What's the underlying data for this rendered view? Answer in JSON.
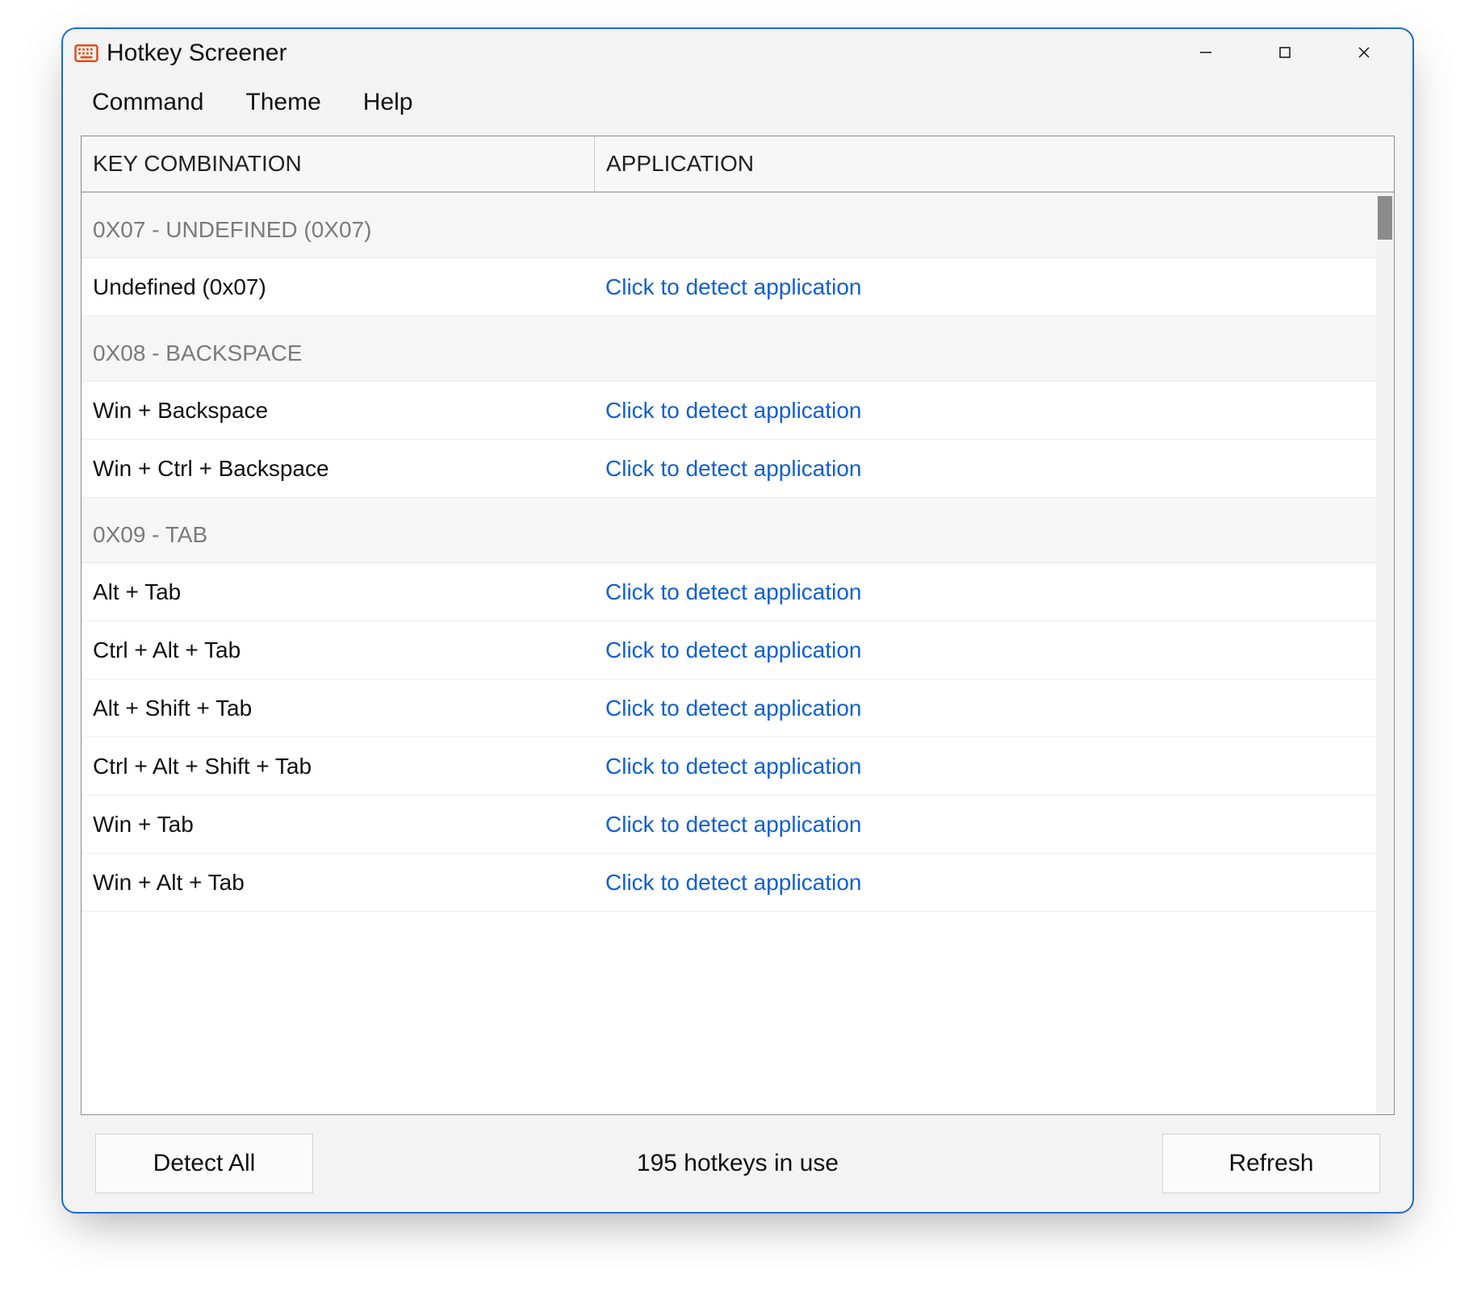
{
  "window": {
    "title": "Hotkey Screener"
  },
  "menubar": {
    "command": "Command",
    "theme": "Theme",
    "help": "Help"
  },
  "table": {
    "headers": {
      "key": "KEY COMBINATION",
      "app": "APPLICATION"
    },
    "detect_label": "Click to detect application",
    "groups": [
      {
        "title": "0X07 - UNDEFINED (0X07)",
        "rows": [
          {
            "key": "Undefined (0x07)"
          }
        ]
      },
      {
        "title": "0X08 - BACKSPACE",
        "rows": [
          {
            "key": "Win + Backspace"
          },
          {
            "key": "Win + Ctrl + Backspace"
          }
        ]
      },
      {
        "title": "0X09 - TAB",
        "rows": [
          {
            "key": "Alt + Tab"
          },
          {
            "key": "Ctrl + Alt + Tab"
          },
          {
            "key": "Alt + Shift + Tab"
          },
          {
            "key": "Ctrl + Alt + Shift + Tab"
          },
          {
            "key": "Win + Tab"
          },
          {
            "key": "Win + Alt + Tab"
          }
        ]
      }
    ]
  },
  "bottom": {
    "detect_all": "Detect All",
    "status": "195 hotkeys in use",
    "refresh": "Refresh"
  }
}
